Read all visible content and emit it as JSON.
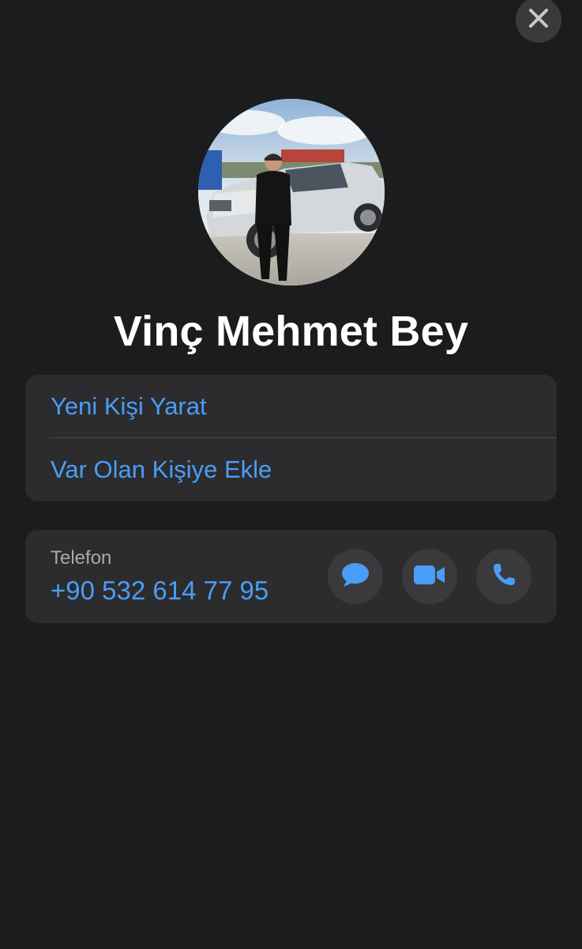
{
  "contact": {
    "name": "Vinç Mehmet Bey"
  },
  "actions": {
    "create_new_contact": "Yeni Kişi Yarat",
    "add_to_existing_contact": "Var Olan Kişiye Ekle"
  },
  "phone": {
    "label": "Telefon",
    "number": "+90 532 614 77 95"
  },
  "icons": {
    "close": "close-icon",
    "message": "message-bubble-icon",
    "video": "video-camera-icon",
    "call": "phone-handset-icon"
  },
  "colors": {
    "background": "#1c1c1e",
    "card": "#2c2c2e",
    "button": "#3a3a3c",
    "accent": "#4a9df8",
    "secondary_text": "#a8a8ad"
  }
}
